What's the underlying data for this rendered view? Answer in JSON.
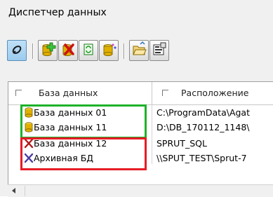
{
  "window": {
    "title": "Диспетчер данных"
  },
  "toolbar": {
    "buttons": [
      {
        "icon": "connect-icon",
        "pressed": true
      },
      {
        "icon": "add-database-icon"
      },
      {
        "icon": "delete-database-icon"
      },
      {
        "icon": "refresh-database-icon"
      },
      {
        "icon": "database-properties-icon"
      },
      {
        "icon": "open-folder-icon"
      },
      {
        "icon": "settings-icon"
      }
    ]
  },
  "grid": {
    "columns": [
      "База данных",
      "Расположение"
    ],
    "rows": [
      {
        "name": "База данных 01",
        "location": "C:\\ProgramData\\Agat",
        "status": "connected"
      },
      {
        "name": "База данных 11",
        "location": "D:\\DB_170112_1148\\",
        "status": "connected"
      },
      {
        "name": "База данных 12",
        "location": "SPRUT_SQL",
        "status": "unavailable"
      },
      {
        "name": "Архивная БД",
        "location": "\\\\SPUT_TEST\\Sprut-7",
        "status": "unavailable"
      }
    ]
  },
  "colors": {
    "highlight_ok": "#1eb12a",
    "highlight_error": "#e81c25",
    "db_icon": "#e0b000",
    "error_icon": "#b01818"
  }
}
